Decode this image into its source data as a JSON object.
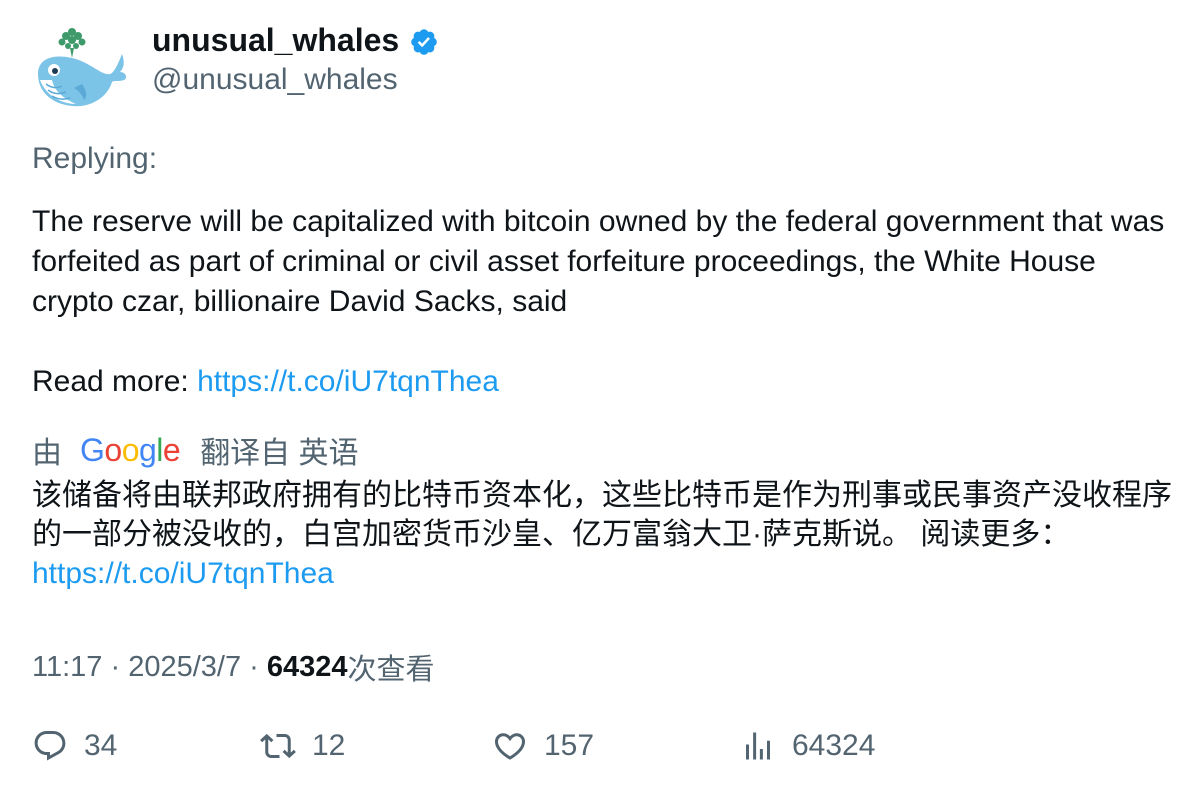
{
  "author": {
    "name": "unusual_whales",
    "handle": "@unusual_whales"
  },
  "replying_label": "Replying:",
  "tweet": {
    "paragraph1": "The reserve will be capitalized with bitcoin owned by the federal government that was forfeited as part of criminal or civil asset forfeiture proceedings, the White House crypto czar, billionaire David Sacks, said",
    "read_more_label": "Read more: ",
    "link": "https://t.co/iU7tqnThea"
  },
  "translation": {
    "by_prefix": "由",
    "google_letters": [
      "G",
      "o",
      "o",
      "g",
      "l",
      "e"
    ],
    "by_suffix": "翻译自 英语",
    "text": "该储备将由联邦政府拥有的比特币资本化，这些比特币是作为刑事或民事资产没收程序的一部分被没收的，白宫加密货币沙皇、亿万富翁大卫·萨克斯说。 阅读更多：",
    "link": "https://t.co/iU7tqnThea"
  },
  "meta": {
    "time": "11:17",
    "sep1": " · ",
    "date": "2025/3/7",
    "sep2": " · ",
    "views_count": "64324",
    "views_label": "次查看"
  },
  "actions": {
    "replies": "34",
    "retweets": "12",
    "likes": "157",
    "views": "64324"
  },
  "colors": {
    "link": "#1d9bf0",
    "secondary_text": "#536471",
    "primary_text": "#0f1419",
    "verified": "#1d9bf0",
    "google_blue": "#4285F4",
    "google_red": "#EA4335",
    "google_yellow": "#FBBC05",
    "google_green": "#34A853"
  }
}
